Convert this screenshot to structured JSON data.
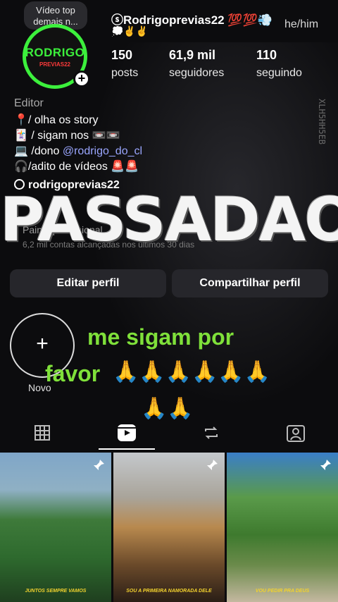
{
  "profile": {
    "note_bubble": [
      "Vídeo top",
      "demais n..."
    ],
    "avatar_text": "RODRIGO",
    "avatar_subtext": "PREVIAS22",
    "username": "ⓢRodrigoprevias22 💯💯💨",
    "username_line2": "💭✌️✌️",
    "pronouns": "he/him",
    "stats": [
      {
        "value": "150",
        "label": "posts"
      },
      {
        "value": "61,9 mil",
        "label": "seguidores"
      },
      {
        "value": "110",
        "label": "seguindo"
      }
    ],
    "category": "Editor",
    "bio": {
      "line1": "📍/ olha os story",
      "line2": "🃏 / sigam nos 📼📼",
      "line3_prefix": "💻 /dono ",
      "line3_mention": "@rodrigo_do_cl",
      "line4": "🎧/adito de vídeos 🚨🚨"
    },
    "threads_handle": "rodrigoprevias22",
    "dashboard_label": "Painel profissional",
    "dashboard_sub": "6,2 mil contas alcançadas nos últimos 30 dias",
    "overlay_title": "PASSADAO",
    "side_text": "XLH5HH5EB"
  },
  "buttons": {
    "edit": "Editar perfil",
    "share": "Compartilhar perfil"
  },
  "highlights": {
    "new_label": "Novo"
  },
  "overlay_caption": {
    "line1": "me sigam por",
    "line2": "favor",
    "hands_line1": "🙏🙏🙏🙏🙏🙏",
    "hands_line2": "🙏🙏"
  },
  "tabs": [
    "grid-icon",
    "reels-icon",
    "reposts-icon",
    "tagged-icon"
  ],
  "thumbnails": [
    {
      "caption": "JUNTOS SEMPRE VAMOS"
    },
    {
      "caption": "SOU A PRIMEIRA NAMORADA DELE"
    },
    {
      "caption": "VOU PEDIR PRA DEUS"
    }
  ],
  "colors": {
    "accent_green": "#3cf03c",
    "caption_green": "#7fe03a",
    "mention": "#9aa6ff",
    "button_bg": "#26262b"
  }
}
